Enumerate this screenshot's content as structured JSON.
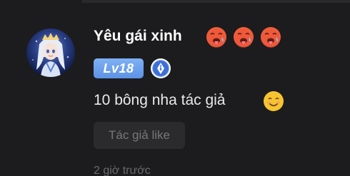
{
  "comment": {
    "username": "Yêu gái xinh",
    "username_emojis": [
      "hot-face-emoji",
      "hot-face-emoji",
      "hot-face-emoji"
    ],
    "level_badge": "Lv18",
    "writer_badge_icon": "fountain-pen-icon",
    "text": "10 bông nha tác giả",
    "text_emoji": "smiling-face-emoji",
    "author_like_label": "Tác giả like",
    "timestamp": "2 giờ trước"
  },
  "colors": {
    "background": "#1c1c1e",
    "username": "#ffffff",
    "comment_text": "#e9e9ea",
    "level_badge": "#6b9eec",
    "writer_badge": "#3e6fd6",
    "chip_background": "#2b2b2d",
    "muted_text": "#6b6b6f"
  }
}
